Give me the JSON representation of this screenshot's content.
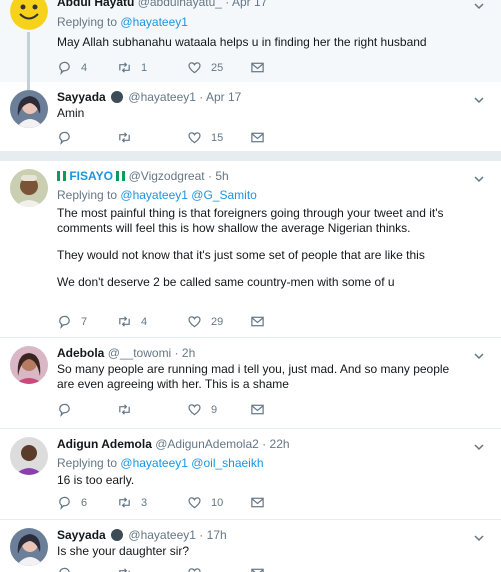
{
  "tweets": [
    {
      "name": "Abdul Hayatu",
      "handle": "@abdulhayatu_",
      "time": "Apr 17",
      "reply_prefix": "Replying to",
      "mentions": [
        "@hayateey1"
      ],
      "text": [
        "May Allah subhanahu wataala helps u in finding her the right husband"
      ],
      "replies": "4",
      "retweets": "1",
      "likes": "25"
    },
    {
      "name": "Sayyada",
      "handle": "@hayateey1",
      "time": "Apr 17",
      "text": [
        "Amin"
      ],
      "replies": "",
      "retweets": "",
      "likes": "15"
    },
    {
      "name_parts": [
        "FISAYO"
      ],
      "handle": "@Vigzodgreat",
      "time": "5h",
      "reply_prefix": "Replying to",
      "mentions": [
        "@hayateey1",
        "@G_Samito"
      ],
      "text": [
        "The most painful thing is that foreigners going through your tweet and it's comments will feel this is how shallow the average Nigerian thinks.",
        "They would not know that it's just some set of people that are like this",
        "We don't deserve 2 be called same country-men with some of u"
      ],
      "replies": "7",
      "retweets": "4",
      "likes": "29"
    },
    {
      "name": "Adebola",
      "handle": "@__towomi",
      "time": "2h",
      "text": [
        "So many people are running mad i tell you, just mad. And so many people are even agreeing with her. This is a shame"
      ],
      "replies": "",
      "retweets": "",
      "likes": "9"
    },
    {
      "name": "Adigun Ademola",
      "handle": "@AdigunAdemola2",
      "time": "22h",
      "reply_prefix": "Replying to",
      "mentions": [
        "@hayateey1",
        "@oil_shaeikh"
      ],
      "text": [
        "16 is too early."
      ],
      "replies": "6",
      "retweets": "3",
      "likes": "10"
    },
    {
      "name": "Sayyada",
      "handle": "@hayateey1",
      "time": "17h",
      "text": [
        "Is she your daughter sir?"
      ],
      "replies": "",
      "retweets": "",
      "likes": ""
    }
  ],
  "separator": "·",
  "colors": {
    "link": "#1b95e0",
    "muted": "#657786",
    "text": "#14171a",
    "highlight_bg": "#f5f8fa",
    "border": "#e6ecf0"
  }
}
